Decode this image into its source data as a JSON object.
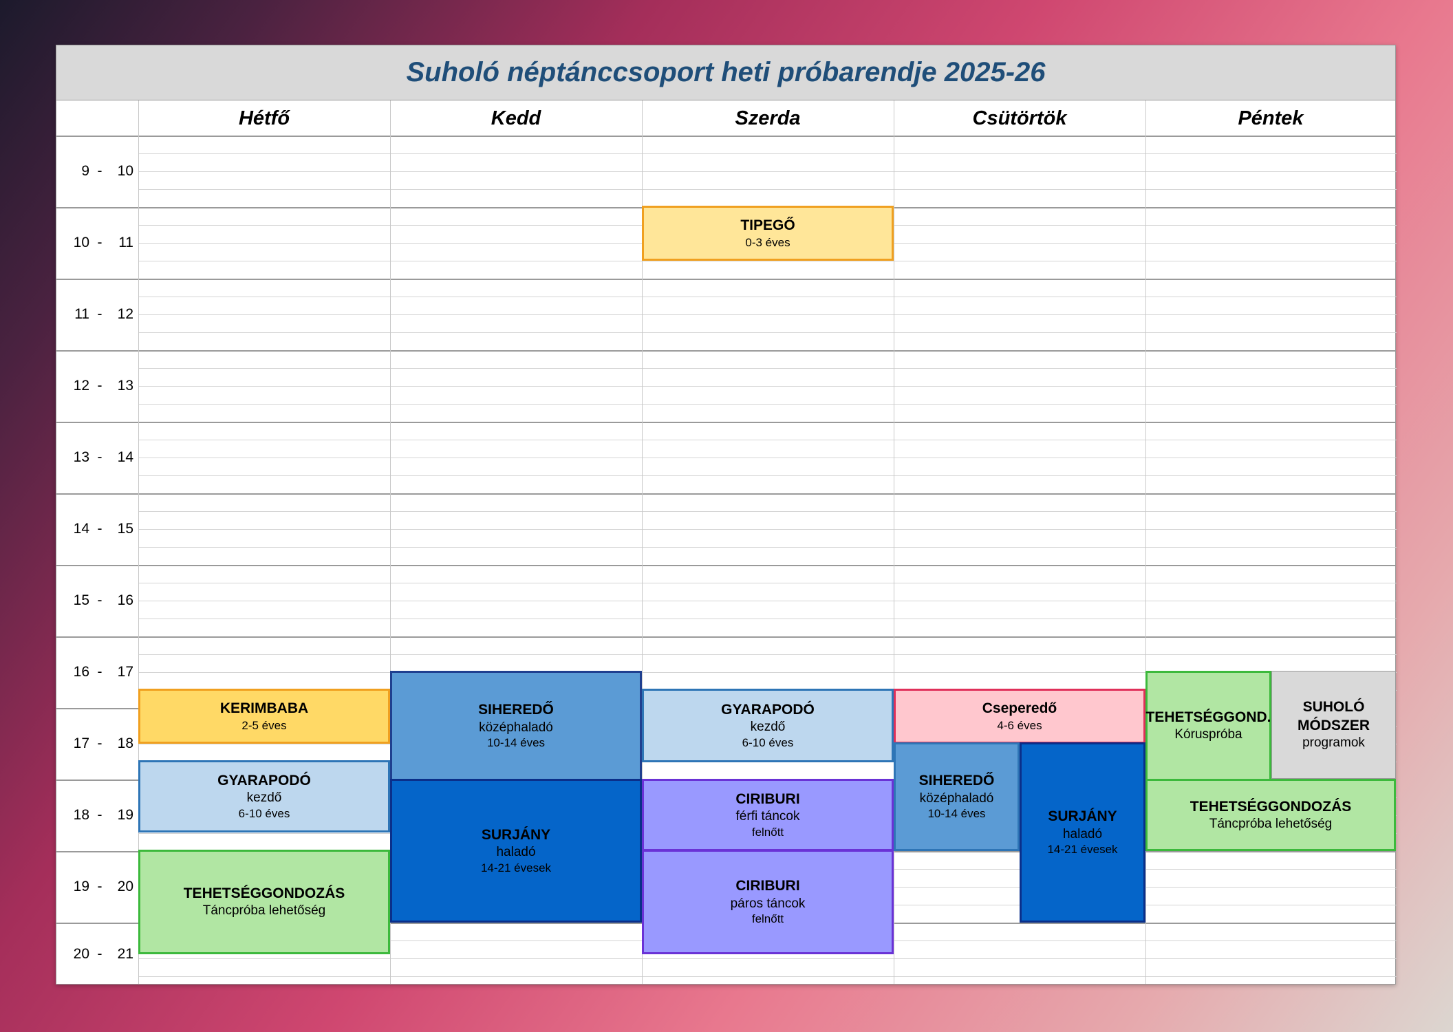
{
  "title": "Suholó néptánccsoport heti próbarendje 2025-26",
  "days": [
    "Hétfő",
    "Kedd",
    "Szerda",
    "Csütörtök",
    "Péntek"
  ],
  "hours": [
    {
      "from": "9",
      "to": "10"
    },
    {
      "from": "10",
      "to": "11"
    },
    {
      "from": "11",
      "to": "12"
    },
    {
      "from": "12",
      "to": "13"
    },
    {
      "from": "13",
      "to": "14"
    },
    {
      "from": "14",
      "to": "15"
    },
    {
      "from": "15",
      "to": "16"
    },
    {
      "from": "16",
      "to": "17"
    },
    {
      "from": "17",
      "to": "18"
    },
    {
      "from": "18",
      "to": "19"
    },
    {
      "from": "19",
      "to": "20"
    },
    {
      "from": "20",
      "to": "21"
    }
  ],
  "hour_separator": "-",
  "events": {
    "tipego": {
      "title": "TIPEGŐ",
      "line1": "0-3 éves",
      "fill": "#ffe699",
      "border": "#f0a020"
    },
    "kerimbaba": {
      "title": "KERIMBABA",
      "line1": "2-5 éves",
      "fill": "#ffd966",
      "border": "#f0a020"
    },
    "gyarapodo_mon": {
      "title": "GYARAPODÓ",
      "line1": "kezdő",
      "line2": "6-10 éves",
      "fill": "#bdd7ee",
      "border": "#2e75b6"
    },
    "tehetseg_mon": {
      "title": "TEHETSÉGGONDOZÁS",
      "line1": "Táncpróba lehetőség",
      "fill": "#b1e6a3",
      "border": "#3cb93c"
    },
    "siheredo_tue": {
      "title": "SIHEREDŐ",
      "line1": "középhaladó",
      "line2": "10-14 éves",
      "fill": "#5b9bd5",
      "border": "#1f3f8f"
    },
    "surjany_tue": {
      "title": "SURJÁNY",
      "line1": "haladó",
      "line2": "14-21 évesek",
      "fill": "#0565c9",
      "border": "#0a2f8a"
    },
    "gyarapodo_wed": {
      "title": "GYARAPODÓ",
      "line1": "kezdő",
      "line2": "6-10 éves",
      "fill": "#bdd7ee",
      "border": "#2e75b6"
    },
    "ciriburi_1": {
      "title": "CIRIBURI",
      "line1": "férfi táncok",
      "line2": "felnőtt",
      "fill": "#9999ff",
      "border": "#6a32d6"
    },
    "ciriburi_2": {
      "title": "CIRIBURI",
      "line1": "páros táncok",
      "line2": "felnőtt",
      "fill": "#9999ff",
      "border": "#6a32d6"
    },
    "csepereddo": {
      "title": "Cseperedő",
      "line1": "4-6 éves",
      "fill": "#ffc7ce",
      "border": "#e0305a"
    },
    "siheredo_thu": {
      "title": "SIHEREDŐ",
      "line1": "középhaladó",
      "line2": "10-14 éves",
      "fill": "#5b9bd5",
      "border": "#2e75b6"
    },
    "surjany_thu": {
      "title": "SURJÁNY",
      "line1": "haladó",
      "line2": "14-21 évesek",
      "fill": "#0565c9",
      "border": "#0a2f8a"
    },
    "tehetseggond_fri": {
      "title": "TEHETSÉGGOND.",
      "line1": "Kóruspróba",
      "fill": "#b1e6a3",
      "border": "#3cb93c"
    },
    "suholo_modszer": {
      "title": "SUHOLÓ",
      "title2": "MÓDSZER",
      "line1": "programok",
      "fill": "#d9d9d9",
      "border": "#9a9a9a"
    },
    "tehetseg_fri": {
      "title": "TEHETSÉGGONDOZÁS",
      "line1": "Táncpróba lehetőség",
      "fill": "#b1e6a3",
      "border": "#3cb93c"
    }
  }
}
